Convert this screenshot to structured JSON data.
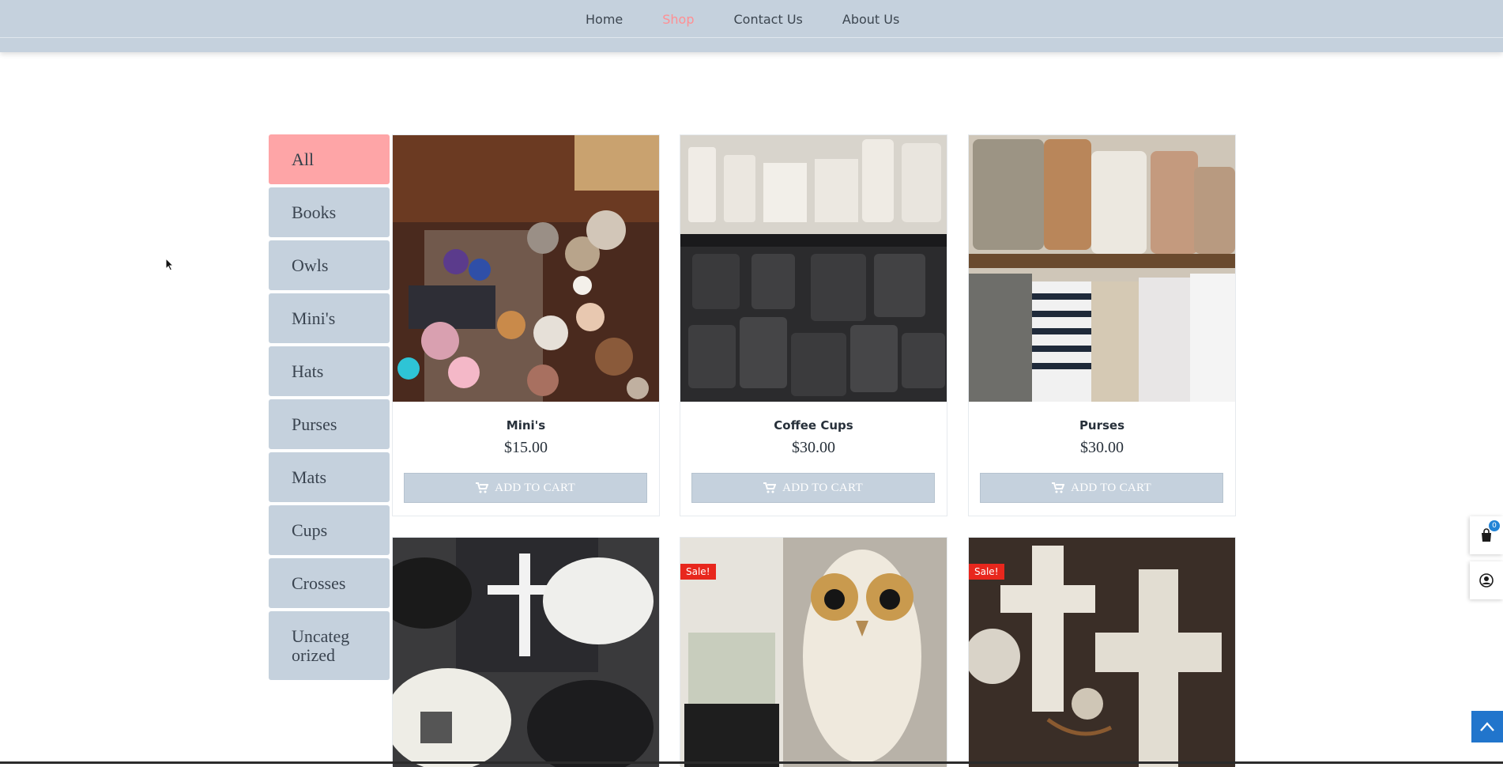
{
  "nav": {
    "items": [
      {
        "label": "Home",
        "active": false
      },
      {
        "label": "Shop",
        "active": true
      },
      {
        "label": "Contact Us",
        "active": false
      },
      {
        "label": "About Us",
        "active": false
      }
    ]
  },
  "sidebar": {
    "categories": [
      {
        "label": "All",
        "active": true
      },
      {
        "label": "Books",
        "active": false
      },
      {
        "label": "Owls",
        "active": false
      },
      {
        "label": "Mini's",
        "active": false
      },
      {
        "label": "Hats",
        "active": false
      },
      {
        "label": "Purses",
        "active": false
      },
      {
        "label": "Mats",
        "active": false
      },
      {
        "label": "Cups",
        "active": false
      },
      {
        "label": "Crosses",
        "active": false
      },
      {
        "label": "Uncateg orized",
        "active": false
      }
    ]
  },
  "products": [
    {
      "name": "Mini's",
      "price": "$15.00",
      "cart_label": "ADD TO CART"
    },
    {
      "name": "Coffee Cups",
      "price": "$30.00",
      "cart_label": "ADD TO CART"
    },
    {
      "name": "Purses",
      "price": "$30.00",
      "cart_label": "ADD TO CART"
    },
    {
      "sale": ""
    },
    {
      "sale": "Sale!"
    },
    {
      "sale": "Sale!"
    }
  ],
  "cart_widget": {
    "count": "0"
  },
  "colors": {
    "header": "#c5d1dd",
    "accent_pink": "#fea5a7",
    "nav_active": "#ff8f93",
    "sale_red": "#e8271d",
    "to_top_blue": "#2175cc"
  }
}
